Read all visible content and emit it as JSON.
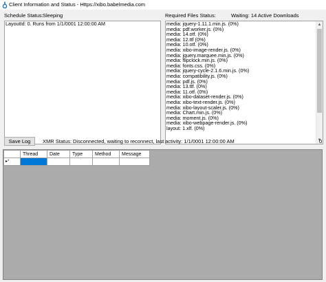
{
  "window": {
    "title": "Client Information and Status - Https://xibo.babelmedia.com"
  },
  "schedule": {
    "label": "Schedule Status:",
    "value": "Sleeping",
    "lines": [
      "LayoutId: 0. Runs from 1/1/0001 12:00:00 AM"
    ]
  },
  "required_files": {
    "label": "Required Files Status:",
    "value": "Waiting: 14 Active Downloads",
    "lines": [
      "media: jquery-1.11.1.min.js. (0%)",
      "media: pdf.worker.js. (0%)",
      "media: 14.otf. (0%)",
      "media: 12.ttf (0%)",
      "media: 10.otf. (0%)",
      "media: xibo-image-render.js. (0%)",
      "media: jquery.marquee.min.js. (0%)",
      "media: flipclock.min.js. (0%)",
      "media: fonts.css. (0%)",
      "media: jquery-cycle-2.1.6.min.js. (0%)",
      "media: compatibility.js. (0%)",
      "media: pdf.js. (0%)",
      "media: 13.ttf. (0%)",
      "media: 11.otf. (0%)",
      "media: xibo-dataset-render.js. (0%)",
      "media: xibo-text-render.js. (0%)",
      "media: xibo-layout-scaler.js. (0%)",
      "media: Chart.min.js. (0%)",
      "media: moment.js. (0%)",
      "media: xibo-webpage-render.js. (0%)",
      "layout: 1.xlf. (0%)"
    ]
  },
  "toolbar": {
    "save_log_label": "Save Log",
    "xmr_label": "XMR Status:",
    "xmr_value": "Disconnected, waiting to reconnect, last activity: 1/1/0001 12:00:00 AM",
    "count": "0"
  },
  "log_grid": {
    "columns": [
      "Thread",
      "Date",
      "Type",
      "Method",
      "Message"
    ],
    "row_indicator": "▸*"
  },
  "colors": {
    "selection": "#0078d7",
    "grid_background": "#ababab",
    "window_background": "#f0f0f0"
  }
}
